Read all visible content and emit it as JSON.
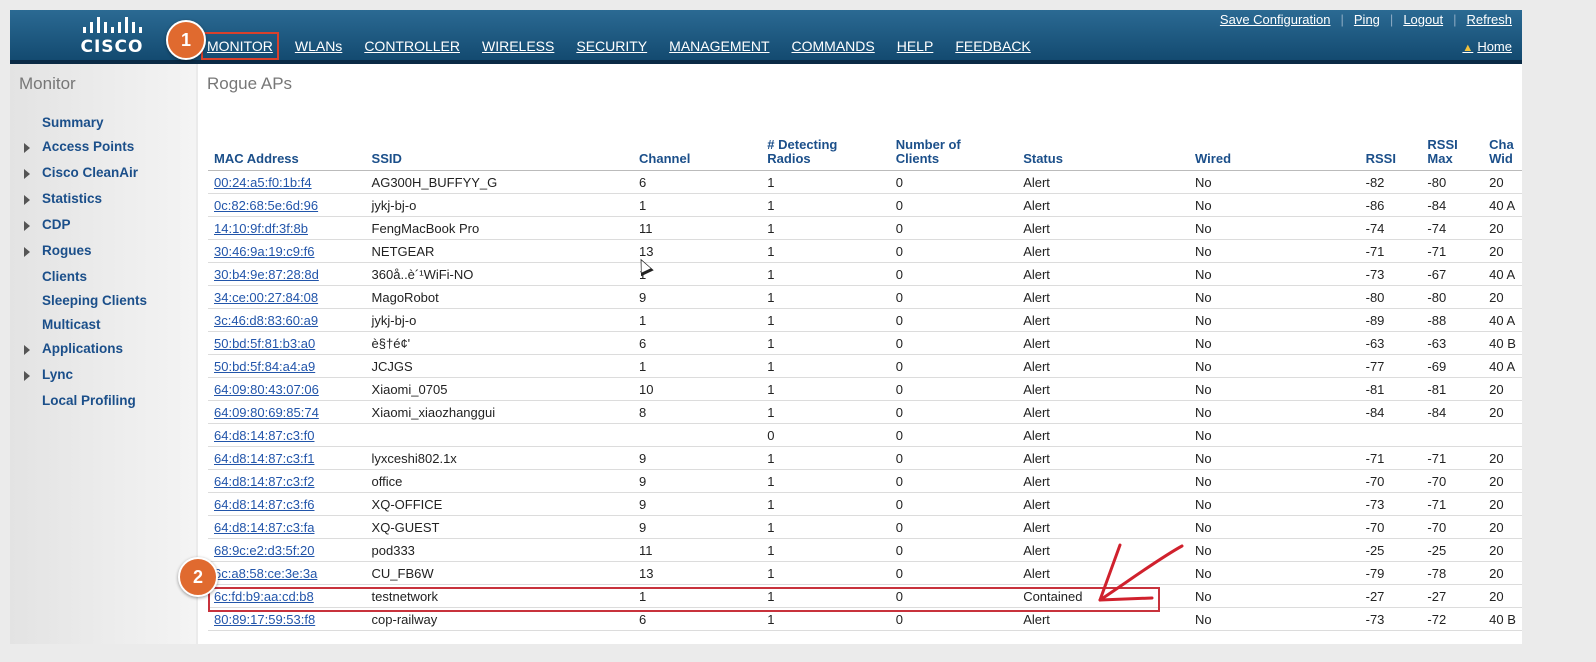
{
  "brand": {
    "logo_text": "CISCO"
  },
  "nav": {
    "items": [
      "MONITOR",
      "WLANs",
      "CONTROLLER",
      "WIRELESS",
      "SECURITY",
      "MANAGEMENT",
      "COMMANDS",
      "HELP",
      "FEEDBACK"
    ]
  },
  "toplinks": {
    "save": "Save Configuration",
    "ping": "Ping",
    "logout": "Logout",
    "refresh": "Refresh",
    "home": "Home"
  },
  "markers": {
    "one": "1",
    "two": "2"
  },
  "sidebar": {
    "title": "Monitor",
    "items": [
      {
        "label": "Summary",
        "expandable": false
      },
      {
        "label": "Access Points",
        "expandable": true
      },
      {
        "label": "Cisco CleanAir",
        "expandable": true
      },
      {
        "label": "Statistics",
        "expandable": true
      },
      {
        "label": "CDP",
        "expandable": true
      },
      {
        "label": "Rogues",
        "expandable": true
      },
      {
        "label": "Clients",
        "expandable": false
      },
      {
        "label": "Sleeping Clients",
        "expandable": false
      },
      {
        "label": "Multicast",
        "expandable": false
      },
      {
        "label": "Applications",
        "expandable": true
      },
      {
        "label": "Lync",
        "expandable": true
      },
      {
        "label": "Local Profiling",
        "expandable": false
      }
    ]
  },
  "main": {
    "title": "Rogue APs",
    "columns": [
      {
        "l1": "",
        "l2": "MAC Address"
      },
      {
        "l1": "",
        "l2": "SSID"
      },
      {
        "l1": "",
        "l2": "Channel"
      },
      {
        "l1": "# Detecting",
        "l2": "Radios"
      },
      {
        "l1": "Number of",
        "l2": "Clients"
      },
      {
        "l1": "",
        "l2": "Status"
      },
      {
        "l1": "",
        "l2": "Wired"
      },
      {
        "l1": "",
        "l2": "RSSI"
      },
      {
        "l1": "RSSI",
        "l2": "Max"
      },
      {
        "l1": "Cha",
        "l2": "Wid"
      }
    ],
    "rows": [
      [
        "00:24:a5:f0:1b:f4",
        "AG300H_BUFFYY_G",
        "6",
        "1",
        "0",
        "Alert",
        "No",
        "-82",
        "-80",
        "20"
      ],
      [
        "0c:82:68:5e:6d:96",
        "jykj-bj-o",
        "1",
        "1",
        "0",
        "Alert",
        "No",
        "-86",
        "-84",
        "40 A"
      ],
      [
        "14:10:9f:df:3f:8b",
        "FengMacBook Pro",
        "11",
        "1",
        "0",
        "Alert",
        "No",
        "-74",
        "-74",
        "20"
      ],
      [
        "30:46:9a:19:c9:f6",
        "NETGEAR",
        "13",
        "1",
        "0",
        "Alert",
        "No",
        "-71",
        "-71",
        "20"
      ],
      [
        "30:b4:9e:87:28:8d",
        "360å..è´¹WiFi-NO",
        "1",
        "1",
        "0",
        "Alert",
        "No",
        "-73",
        "-67",
        "40 A"
      ],
      [
        "34:ce:00:27:84:08",
        "MagoRobot",
        "9",
        "1",
        "0",
        "Alert",
        "No",
        "-80",
        "-80",
        "20"
      ],
      [
        "3c:46:d8:83:60:a9",
        "jykj-bj-o",
        "1",
        "1",
        "0",
        "Alert",
        "No",
        "-89",
        "-88",
        "40 A"
      ],
      [
        "50:bd:5f:81:b3:a0",
        "è§†é¢'",
        "6",
        "1",
        "0",
        "Alert",
        "No",
        "-63",
        "-63",
        "40 B"
      ],
      [
        "50:bd:5f:84:a4:a9",
        "JCJGS",
        "1",
        "1",
        "0",
        "Alert",
        "No",
        "-77",
        "-69",
        "40 A"
      ],
      [
        "64:09:80:43:07:06",
        "Xiaomi_0705",
        "10",
        "1",
        "0",
        "Alert",
        "No",
        "-81",
        "-81",
        "20"
      ],
      [
        "64:09:80:69:85:74",
        "Xiaomi_xiaozhanggui",
        "8",
        "1",
        "0",
        "Alert",
        "No",
        "-84",
        "-84",
        "20"
      ],
      [
        "64:d8:14:87:c3:f0",
        "",
        "",
        "0",
        "0",
        "Alert",
        "No",
        "",
        "",
        ""
      ],
      [
        "64:d8:14:87:c3:f1",
        "lyxceshi802.1x",
        "9",
        "1",
        "0",
        "Alert",
        "No",
        "-71",
        "-71",
        "20"
      ],
      [
        "64:d8:14:87:c3:f2",
        "office",
        "9",
        "1",
        "0",
        "Alert",
        "No",
        "-70",
        "-70",
        "20"
      ],
      [
        "64:d8:14:87:c3:f6",
        " XQ-OFFICE",
        "9",
        "1",
        "0",
        "Alert",
        "No",
        "-73",
        "-71",
        "20"
      ],
      [
        "64:d8:14:87:c3:fa",
        " XQ-GUEST",
        "9",
        "1",
        "0",
        "Alert",
        "No",
        "-70",
        "-70",
        "20"
      ],
      [
        "68:9c:e2:d3:5f:20",
        "pod333",
        "11",
        "1",
        "0",
        "Alert",
        "No",
        "-25",
        "-25",
        "20"
      ],
      [
        "6c:a8:58:ce:3e:3a",
        "CU_FB6W",
        "13",
        "1",
        "0",
        "Alert",
        "No",
        "-79",
        "-78",
        "20"
      ],
      [
        "6c:fd:b9:aa:cd:b8",
        "testnetwork",
        "1",
        "1",
        "0",
        "Contained",
        "No",
        "-27",
        "-27",
        "20"
      ],
      [
        "80:89:17:59:53:f8",
        "cop-railway",
        "6",
        "1",
        "0",
        "Alert",
        "No",
        "-73",
        "-72",
        "40 B"
      ]
    ]
  },
  "colors": {
    "accent": "#c8323c",
    "marker": "#e06a2f",
    "link": "#2255aa"
  }
}
